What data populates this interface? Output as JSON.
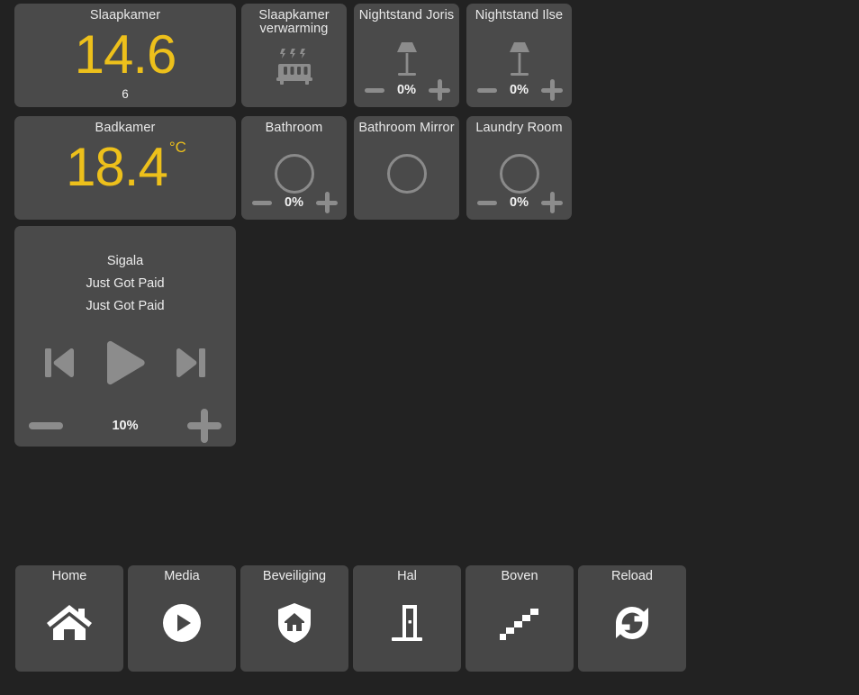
{
  "theme": {
    "background": "#222222",
    "tile_background": "#4a4a4a",
    "accent_value": "#edc01b",
    "icon_grey": "#8c8c8c",
    "text": "#ededed"
  },
  "cards": {
    "bedroom_temp": {
      "title": "Slaapkamer",
      "value": "14.6",
      "unit": "",
      "subtitle": "6",
      "icon": "thermometer-value"
    },
    "bedroom_heating": {
      "title_line1": "Slaapkamer",
      "title_line2": "verwarming",
      "icon": "radiator-icon"
    },
    "nightstand_joris": {
      "title": "Nightstand Joris",
      "icon": "lamp-icon",
      "brightness": "0%",
      "minus_label": "–",
      "plus_label": "+"
    },
    "nightstand_ilse": {
      "title": "Nightstand Ilse",
      "icon": "lamp-icon",
      "brightness": "0%",
      "minus_label": "–",
      "plus_label": "+"
    },
    "bathroom_temp": {
      "title": "Badkamer",
      "value": "18.4",
      "unit": "°C",
      "subtitle": ""
    },
    "bathroom_light": {
      "title": "Bathroom",
      "icon": "light-circle-icon",
      "brightness": "0%"
    },
    "bathroom_mirror": {
      "title": "Bathroom Mirror",
      "icon": "light-circle-icon"
    },
    "laundry_room": {
      "title": "Laundry Room",
      "icon": "light-circle-icon",
      "brightness": "0%"
    },
    "media_player": {
      "artist": "Sigala",
      "album": "Just Got Paid",
      "track": "Just Got Paid",
      "volume": "10%",
      "previous_icon": "skip-previous-icon",
      "play_icon": "play-icon",
      "next_icon": "skip-next-icon"
    }
  },
  "nav": {
    "items": [
      {
        "label": "Home",
        "icon": "house-icon"
      },
      {
        "label": "Media",
        "icon": "play-circle-icon"
      },
      {
        "label": "Beveiliging",
        "icon": "shield-house-icon"
      },
      {
        "label": "Hal",
        "icon": "door-icon"
      },
      {
        "label": "Boven",
        "icon": "stairs-icon"
      },
      {
        "label": "Reload",
        "icon": "refresh-icon"
      }
    ]
  }
}
